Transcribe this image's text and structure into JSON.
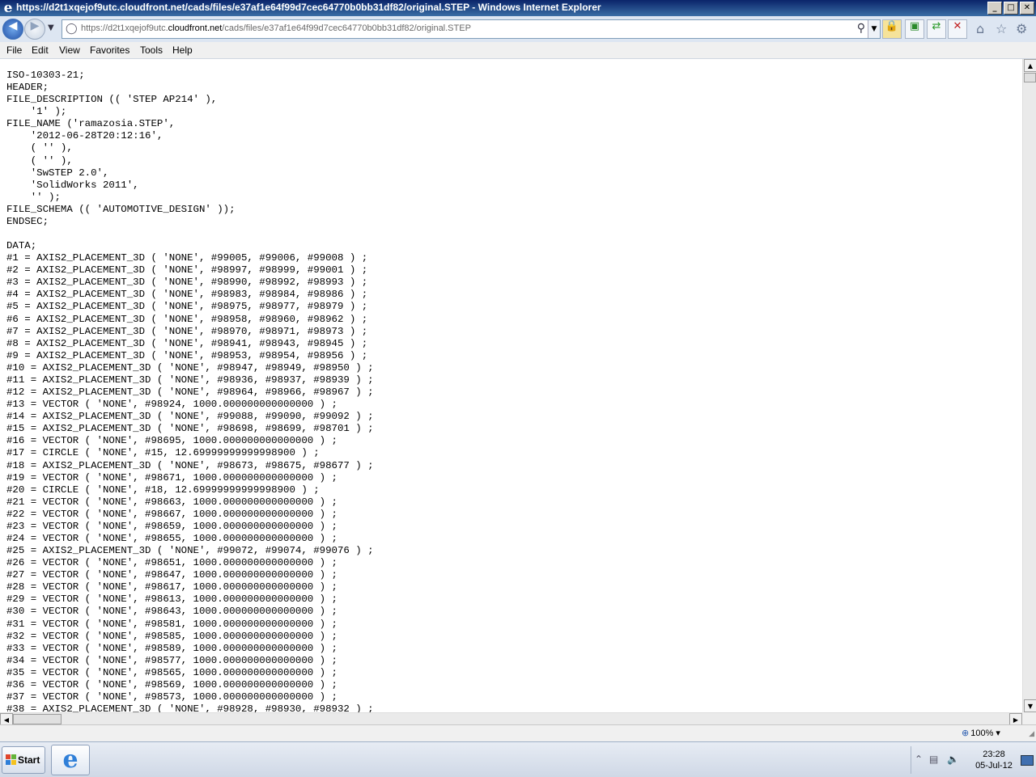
{
  "window": {
    "title": "https://d2t1xqejof9utc.cloudfront.net/cads/files/e37af1e64f99d7cec64770b0bb31df82/original.STEP - Windows Internet Explorer",
    "buttons": {
      "minimize": "_",
      "maximize": "□",
      "close": "✕"
    }
  },
  "address_bar": {
    "url_prefix": "https://d2t1xqejof9utc.",
    "url_domain": "cloudfront.net",
    "url_path": "/cads/files/e37af1e64f99d7cec64770b0bb31df82/original.STEP"
  },
  "icons": {
    "back": "back-arrow-icon",
    "forward": "forward-arrow-icon",
    "lock": "lock-icon",
    "compatibility": "compatibility-view-icon",
    "refresh": "refresh-icon",
    "stop": "stop-icon",
    "home": "home-icon",
    "favorites": "star-icon",
    "tools": "gear-icon"
  },
  "menu": [
    "File",
    "Edit",
    "View",
    "Favorites",
    "Tools",
    "Help"
  ],
  "document": {
    "lines": [
      "ISO-10303-21;",
      "HEADER;",
      "FILE_DESCRIPTION (( 'STEP AP214' ),",
      "    '1' );",
      "FILE_NAME ('ramazosia.STEP',",
      "    '2012-06-28T20:12:16',",
      "    ( '' ),",
      "    ( '' ),",
      "    'SwSTEP 2.0',",
      "    'SolidWorks 2011',",
      "    '' );",
      "FILE_SCHEMA (( 'AUTOMOTIVE_DESIGN' ));",
      "ENDSEC;",
      "",
      "DATA;",
      "#1 = AXIS2_PLACEMENT_3D ( 'NONE', #99005, #99006, #99008 ) ;",
      "#2 = AXIS2_PLACEMENT_3D ( 'NONE', #98997, #98999, #99001 ) ;",
      "#3 = AXIS2_PLACEMENT_3D ( 'NONE', #98990, #98992, #98993 ) ;",
      "#4 = AXIS2_PLACEMENT_3D ( 'NONE', #98983, #98984, #98986 ) ;",
      "#5 = AXIS2_PLACEMENT_3D ( 'NONE', #98975, #98977, #98979 ) ;",
      "#6 = AXIS2_PLACEMENT_3D ( 'NONE', #98958, #98960, #98962 ) ;",
      "#7 = AXIS2_PLACEMENT_3D ( 'NONE', #98970, #98971, #98973 ) ;",
      "#8 = AXIS2_PLACEMENT_3D ( 'NONE', #98941, #98943, #98945 ) ;",
      "#9 = AXIS2_PLACEMENT_3D ( 'NONE', #98953, #98954, #98956 ) ;",
      "#10 = AXIS2_PLACEMENT_3D ( 'NONE', #98947, #98949, #98950 ) ;",
      "#11 = AXIS2_PLACEMENT_3D ( 'NONE', #98936, #98937, #98939 ) ;",
      "#12 = AXIS2_PLACEMENT_3D ( 'NONE', #98964, #98966, #98967 ) ;",
      "#13 = VECTOR ( 'NONE', #98924, 1000.000000000000000 ) ;",
      "#14 = AXIS2_PLACEMENT_3D ( 'NONE', #99088, #99090, #99092 ) ;",
      "#15 = AXIS2_PLACEMENT_3D ( 'NONE', #98698, #98699, #98701 ) ;",
      "#16 = VECTOR ( 'NONE', #98695, 1000.000000000000000 ) ;",
      "#17 = CIRCLE ( 'NONE', #15, 12.69999999999998900 ) ;",
      "#18 = AXIS2_PLACEMENT_3D ( 'NONE', #98673, #98675, #98677 ) ;",
      "#19 = VECTOR ( 'NONE', #98671, 1000.000000000000000 ) ;",
      "#20 = CIRCLE ( 'NONE', #18, 12.69999999999998900 ) ;",
      "#21 = VECTOR ( 'NONE', #98663, 1000.000000000000000 ) ;",
      "#22 = VECTOR ( 'NONE', #98667, 1000.000000000000000 ) ;",
      "#23 = VECTOR ( 'NONE', #98659, 1000.000000000000000 ) ;",
      "#24 = VECTOR ( 'NONE', #98655, 1000.000000000000000 ) ;",
      "#25 = AXIS2_PLACEMENT_3D ( 'NONE', #99072, #99074, #99076 ) ;",
      "#26 = VECTOR ( 'NONE', #98651, 1000.000000000000000 ) ;",
      "#27 = VECTOR ( 'NONE', #98647, 1000.000000000000000 ) ;",
      "#28 = VECTOR ( 'NONE', #98617, 1000.000000000000000 ) ;",
      "#29 = VECTOR ( 'NONE', #98613, 1000.000000000000000 ) ;",
      "#30 = VECTOR ( 'NONE', #98643, 1000.000000000000000 ) ;",
      "#31 = VECTOR ( 'NONE', #98581, 1000.000000000000000 ) ;",
      "#32 = VECTOR ( 'NONE', #98585, 1000.000000000000000 ) ;",
      "#33 = VECTOR ( 'NONE', #98589, 1000.000000000000000 ) ;",
      "#34 = VECTOR ( 'NONE', #98577, 1000.000000000000000 ) ;",
      "#35 = VECTOR ( 'NONE', #98565, 1000.000000000000000 ) ;",
      "#36 = VECTOR ( 'NONE', #98569, 1000.000000000000000 ) ;",
      "#37 = VECTOR ( 'NONE', #98573, 1000.000000000000000 ) ;",
      "#38 = AXIS2_PLACEMENT_3D ( 'NONE', #98928, #98930, #98932 ) ;"
    ]
  },
  "status_bar": {
    "zoom": "100%"
  },
  "taskbar": {
    "start_label": "Start",
    "time": "23:28",
    "date": "05-Jul-12"
  }
}
